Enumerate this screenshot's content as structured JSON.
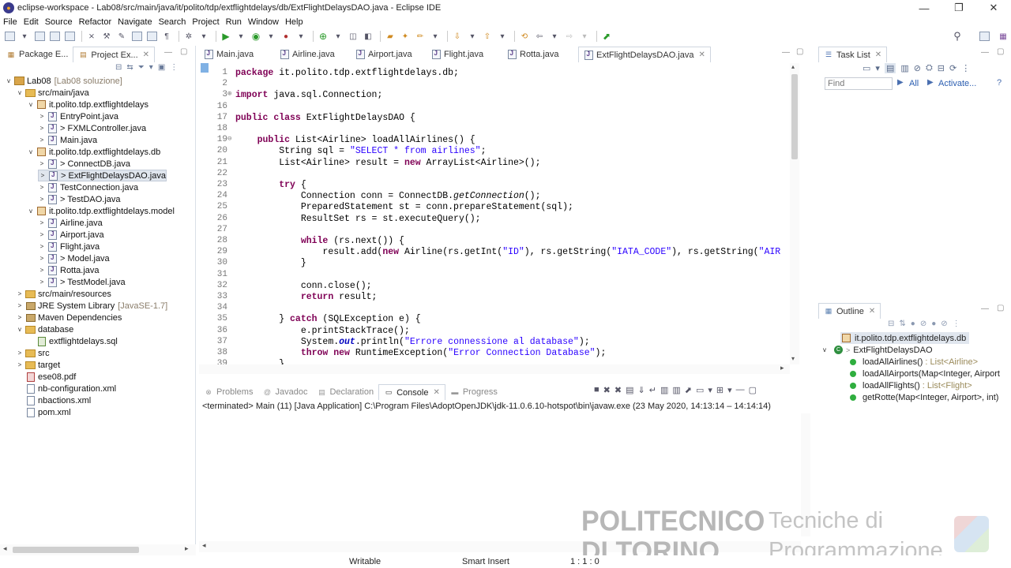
{
  "window": {
    "title": "eclipse-workspace - Lab08/src/main/java/it/polito/tdp/extflightdelays/db/ExtFlightDelaysDAO.java - Eclipse IDE"
  },
  "menu": [
    "File",
    "Edit",
    "Source",
    "Refactor",
    "Navigate",
    "Search",
    "Project",
    "Run",
    "Window",
    "Help"
  ],
  "explorer": {
    "tabs": [
      {
        "label": "Package E..."
      },
      {
        "label": "Project Ex..."
      }
    ],
    "tree": [
      {
        "depth": 0,
        "twisty": "v",
        "icon": "project",
        "label": "Lab08",
        "extra": "[Lab08 soluzione]"
      },
      {
        "depth": 1,
        "twisty": "v",
        "icon": "folder",
        "label": "src/main/java",
        "extra": ""
      },
      {
        "depth": 2,
        "twisty": "v",
        "icon": "package",
        "label": "it.polito.tdp.extflightdelays",
        "extra": ""
      },
      {
        "depth": 3,
        "twisty": ">",
        "icon": "java",
        "label": "EntryPoint.java",
        "extra": ""
      },
      {
        "depth": 3,
        "twisty": ">",
        "icon": "java",
        "label": "> FXMLController.java",
        "extra": ""
      },
      {
        "depth": 3,
        "twisty": ">",
        "icon": "java",
        "label": "Main.java",
        "extra": ""
      },
      {
        "depth": 2,
        "twisty": "v",
        "icon": "package",
        "label": "it.polito.tdp.extflightdelays.db",
        "extra": ""
      },
      {
        "depth": 3,
        "twisty": ">",
        "icon": "java",
        "label": "> ConnectDB.java",
        "extra": ""
      },
      {
        "depth": 3,
        "twisty": ">",
        "icon": "java",
        "label": "> ExtFlightDelaysDAO.java",
        "extra": "",
        "selected": true
      },
      {
        "depth": 3,
        "twisty": ">",
        "icon": "java",
        "label": "TestConnection.java",
        "extra": ""
      },
      {
        "depth": 3,
        "twisty": ">",
        "icon": "java",
        "label": "> TestDAO.java",
        "extra": ""
      },
      {
        "depth": 2,
        "twisty": "v",
        "icon": "package",
        "label": "it.polito.tdp.extflightdelays.model",
        "extra": ""
      },
      {
        "depth": 3,
        "twisty": ">",
        "icon": "java",
        "label": "Airline.java",
        "extra": ""
      },
      {
        "depth": 3,
        "twisty": ">",
        "icon": "java",
        "label": "Airport.java",
        "extra": ""
      },
      {
        "depth": 3,
        "twisty": ">",
        "icon": "java",
        "label": "Flight.java",
        "extra": ""
      },
      {
        "depth": 3,
        "twisty": ">",
        "icon": "java",
        "label": "> Model.java",
        "extra": ""
      },
      {
        "depth": 3,
        "twisty": ">",
        "icon": "java",
        "label": "Rotta.java",
        "extra": ""
      },
      {
        "depth": 3,
        "twisty": ">",
        "icon": "java",
        "label": "> TestModel.java",
        "extra": ""
      },
      {
        "depth": 1,
        "twisty": ">",
        "icon": "folder",
        "label": "src/main/resources",
        "extra": ""
      },
      {
        "depth": 1,
        "twisty": ">",
        "icon": "library",
        "label": "JRE System Library",
        "extra": "[JavaSE-1.7]"
      },
      {
        "depth": 1,
        "twisty": ">",
        "icon": "library",
        "label": "Maven Dependencies",
        "extra": ""
      },
      {
        "depth": 1,
        "twisty": "v",
        "icon": "folder",
        "label": "database",
        "extra": ""
      },
      {
        "depth": 2,
        "twisty": "",
        "icon": "sql",
        "label": "extflightdelays.sql",
        "extra": ""
      },
      {
        "depth": 1,
        "twisty": ">",
        "icon": "folder",
        "label": "src",
        "extra": ""
      },
      {
        "depth": 1,
        "twisty": ">",
        "icon": "folder",
        "label": "target",
        "extra": ""
      },
      {
        "depth": 1,
        "twisty": "",
        "icon": "pdf",
        "label": "ese08.pdf",
        "extra": ""
      },
      {
        "depth": 1,
        "twisty": "",
        "icon": "xml",
        "label": "nb-configuration.xml",
        "extra": ""
      },
      {
        "depth": 1,
        "twisty": "",
        "icon": "xml",
        "label": "nbactions.xml",
        "extra": ""
      },
      {
        "depth": 1,
        "twisty": "",
        "icon": "xml",
        "label": "pom.xml",
        "extra": ""
      }
    ]
  },
  "editor": {
    "tabs": [
      {
        "label": "Main.java"
      },
      {
        "label": "Airline.java"
      },
      {
        "label": "Airport.java"
      },
      {
        "label": "Flight.java"
      },
      {
        "label": "Rotta.java"
      },
      {
        "label": "ExtFlightDelaysDAO.java",
        "active": true
      }
    ],
    "lines": [
      {
        "n": "1",
        "html": "<span class=\"kw\">package</span> it.polito.tdp.extflightdelays.db;"
      },
      {
        "n": "2",
        "html": ""
      },
      {
        "n": "3",
        "html": "<span class=\"kw\">import</span> java.sql.Connection;",
        "fold": "+"
      },
      {
        "n": "16",
        "html": ""
      },
      {
        "n": "17",
        "html": "<span class=\"kw\">public</span> <span class=\"kw\">class</span> ExtFlightDelaysDAO {"
      },
      {
        "n": "18",
        "html": ""
      },
      {
        "n": "19",
        "html": "    <span class=\"kw\">public</span> List&lt;Airline&gt; loadAllAirlines() {",
        "fold": "-"
      },
      {
        "n": "20",
        "html": "        String sql = <span class=\"st\">\"SELECT * from airlines\"</span>;"
      },
      {
        "n": "21",
        "html": "        List&lt;Airline&gt; result = <span class=\"kw\">new</span> ArrayList&lt;Airline&gt;();"
      },
      {
        "n": "22",
        "html": ""
      },
      {
        "n": "23",
        "html": "        <span class=\"kw\">try</span> {"
      },
      {
        "n": "24",
        "html": "            Connection conn = ConnectDB.<span class=\"it\">getConnection</span>();"
      },
      {
        "n": "25",
        "html": "            PreparedStatement st = conn.prepareStatement(sql);"
      },
      {
        "n": "26",
        "html": "            ResultSet rs = st.executeQuery();"
      },
      {
        "n": "27",
        "html": ""
      },
      {
        "n": "28",
        "html": "            <span class=\"kw\">while</span> (rs.next()) {"
      },
      {
        "n": "29",
        "html": "                result.add(<span class=\"kw\">new</span> Airline(rs.getInt(<span class=\"st\">\"ID\"</span>), rs.getString(<span class=\"st\">\"IATA_CODE\"</span>), rs.getString(<span class=\"st\">\"AIR</span>"
      },
      {
        "n": "30",
        "html": "            }"
      },
      {
        "n": "31",
        "html": ""
      },
      {
        "n": "32",
        "html": "            conn.close();"
      },
      {
        "n": "33",
        "html": "            <span class=\"kw\">return</span> result;"
      },
      {
        "n": "34",
        "html": ""
      },
      {
        "n": "35",
        "html": "        } <span class=\"kw\">catch</span> (SQLException e) {"
      },
      {
        "n": "36",
        "html": "            e.printStackTrace();"
      },
      {
        "n": "37",
        "html": "            System.<span class=\"fld\">out</span>.println(<span class=\"st\">\"Errore connessione al database\"</span>);"
      },
      {
        "n": "38",
        "html": "            <span class=\"kw\">throw</span> <span class=\"kw\">new</span> RuntimeException(<span class=\"st\">\"Error Connection Database\"</span>);"
      },
      {
        "n": "39",
        "html": "        }"
      }
    ]
  },
  "console": {
    "tabs": [
      {
        "label": "Problems"
      },
      {
        "label": "Javadoc"
      },
      {
        "label": "Declaration"
      },
      {
        "label": "Console",
        "active": true
      },
      {
        "label": "Progress"
      }
    ],
    "status": "<terminated> Main (11) [Java Application] C:\\Program Files\\AdoptOpenJDK\\jdk-11.0.6.10-hotspot\\bin\\javaw.exe  (23 May 2020, 14:13:14 – 14:14:14)"
  },
  "tasklist": {
    "title": "Task List",
    "find_placeholder": "Find",
    "all_label": "All",
    "activate_label": "Activate..."
  },
  "outline": {
    "title": "Outline",
    "package": "it.polito.tdp.extflightdelays.db",
    "class": "ExtFlightDelaysDAO",
    "members": [
      {
        "name": "loadAllAirlines()",
        "type": ": List<Airline>"
      },
      {
        "name": "loadAllAirports(Map<Integer, Airport",
        "type": ""
      },
      {
        "name": "loadAllFlights()",
        "type": ": List<Flight>"
      },
      {
        "name": "getRotte(Map<Integer, Airport>, int)",
        "type": ""
      }
    ]
  },
  "statusbar": {
    "writable": "Writable",
    "insert": "Smart Insert",
    "position": "1 : 1 : 0"
  },
  "watermark": {
    "line1": "POLITECNICO",
    "line2": "DI TORINO",
    "line3": "Tecniche di",
    "line4": "Programmazione"
  }
}
